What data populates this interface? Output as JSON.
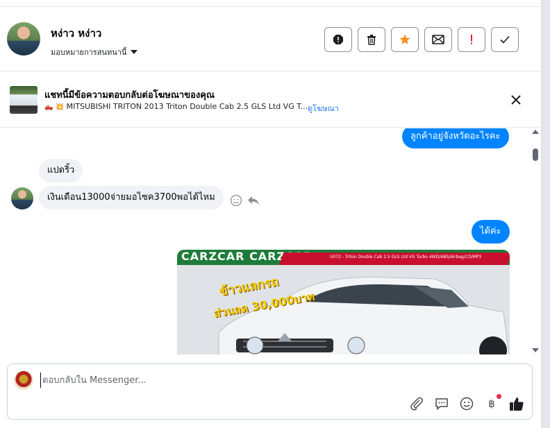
{
  "header": {
    "contact_name": "หง่าว หง่าว",
    "assign_label": "มอบหมายการสนทนานี้",
    "actions": [
      {
        "name": "report-icon"
      },
      {
        "name": "trash-icon"
      },
      {
        "name": "star-icon"
      },
      {
        "name": "mail-icon"
      },
      {
        "name": "exclamation-icon"
      },
      {
        "name": "check-icon"
      }
    ],
    "accent_colors": {
      "star": "#f7931e",
      "exclamation": "#e41e3f"
    }
  },
  "ad": {
    "title": "แชทนี้มีข้อความตอบกลับต่อโฆษณาของคุณ",
    "emoji": "🛻 💥",
    "subtitle": "MITSUBISHI TRITON 2013 Triton Double Cab 2.5 GLS Ltd VG T...",
    "link": "ดูโฆษณา"
  },
  "messages": [
    {
      "side": "out",
      "text": "ลูกค้าอยู่จังหวัดอะไรคะ"
    },
    {
      "side": "in",
      "text": "แปดริ้ว"
    },
    {
      "side": "in",
      "text": "เงินเดือน13000จ่ายมอไซค3700พอได้ไหม"
    },
    {
      "side": "out",
      "text": "ได้ค่ะ"
    }
  ],
  "car_image": {
    "band_text": "CARZCAR CARZCAR",
    "spec_text": "U072 - Triton Double Cab 2.5 GLS Ltd VG Turbo 4WD/ABS/Airbag/CD/MP3",
    "promo_line1": "ข้าวแลกรถ",
    "promo_line2": "ส่วนลด 30,000บาท"
  },
  "composer": {
    "placeholder": "ตอบกลับใน Messenger...",
    "tools": [
      "attach-icon",
      "saved-reply-icon",
      "emoji-icon",
      "baht-icon",
      "like-icon"
    ],
    "baht_symbol": "฿"
  },
  "colors": {
    "outgoing_bubble": "#0084ff",
    "incoming_bubble": "#f0f2f5",
    "link": "#1877f2"
  }
}
